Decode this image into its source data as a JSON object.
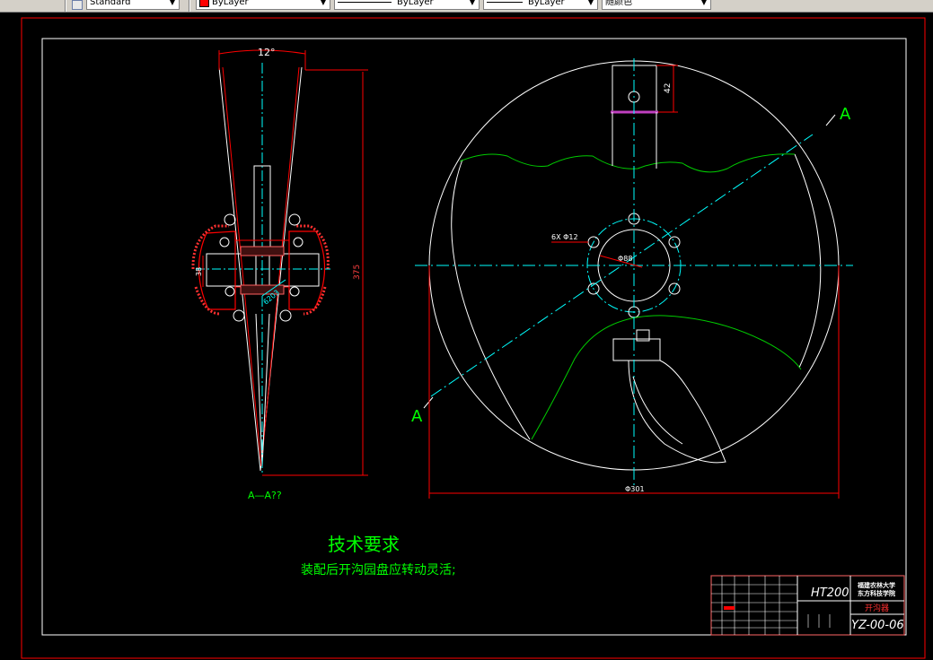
{
  "toolbar": {
    "text_style": "Standard",
    "color": "ByLayer",
    "color_swatch": "#ff0000",
    "linetype": "ByLayer",
    "lineweight": "ByLayer",
    "plot_style": "随颜色"
  },
  "drawing": {
    "section_angle": "12°",
    "dim_375": "375",
    "dim_38": "38",
    "dim_6x": "6X Φ12",
    "dim_88": "Φ88",
    "dim_42": "42",
    "dim_dia": "Φ301",
    "dim_bearing": "6203",
    "section_label_top": "A",
    "section_label_bottom": "A",
    "section_view_label": "A—A??"
  },
  "notes": {
    "title": "技术要求",
    "line1": "装配后开沟园盘应转动灵活;"
  },
  "title_block": {
    "material": "HT200",
    "school1": "福建农林大学",
    "school2": "东方科技学院",
    "part_name": "开沟器",
    "drawing_no": "YZ-00-06"
  },
  "colors": {
    "outline": "#ffffff",
    "center": "#00ffff",
    "dimension": "#ff0000",
    "wave": "#00cc00",
    "text_green": "#00ff00"
  }
}
